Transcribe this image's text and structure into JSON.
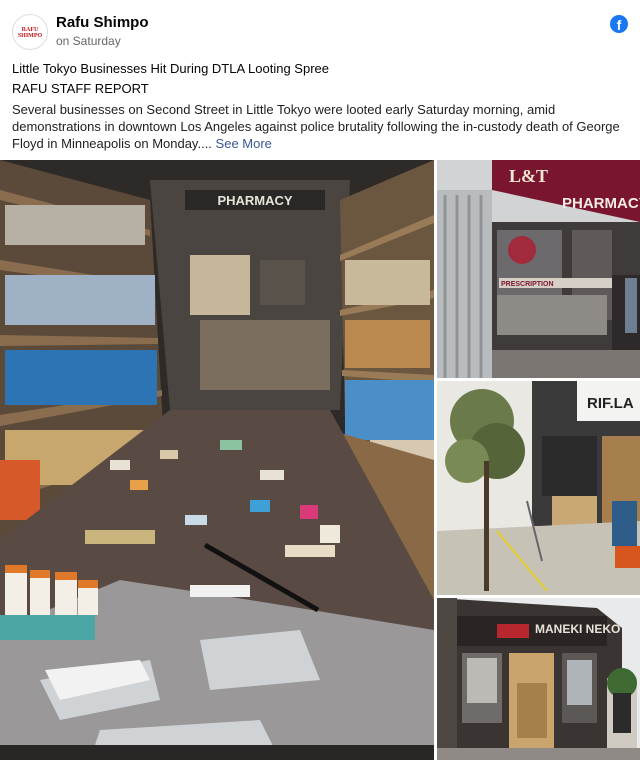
{
  "post": {
    "page_name": "Rafu Shimpo",
    "time": "on Saturday",
    "avatar_logo_line1": "RAFU",
    "avatar_logo_line2": "SHIMPO",
    "headline": "Little Tokyo Businesses Hit During DTLA Looting Spree",
    "byline": "RAFU STAFF REPORT",
    "body": "Several businesses on Second Street in Little Tokyo were looted early Saturday morning, amid demonstrations in downtown Los Angeles against police brutality following the in-custody death of George Floyd in Minneapolis on Monday....",
    "see_more": "See More"
  },
  "photos": {
    "main_sign": "PHARMACY",
    "storefront_sign": "L&T",
    "storefront_sign2": "PHARMACY",
    "storefront_prescription": "PRESCRIPTION",
    "street_sign": "RIF.LA",
    "restaurant_sign": "MANEKI NEKO"
  },
  "icons": {
    "platform": "facebook-icon"
  },
  "colors": {
    "link": "#385898",
    "facebook_blue": "#1877f2",
    "brand_red": "#c0141b"
  }
}
